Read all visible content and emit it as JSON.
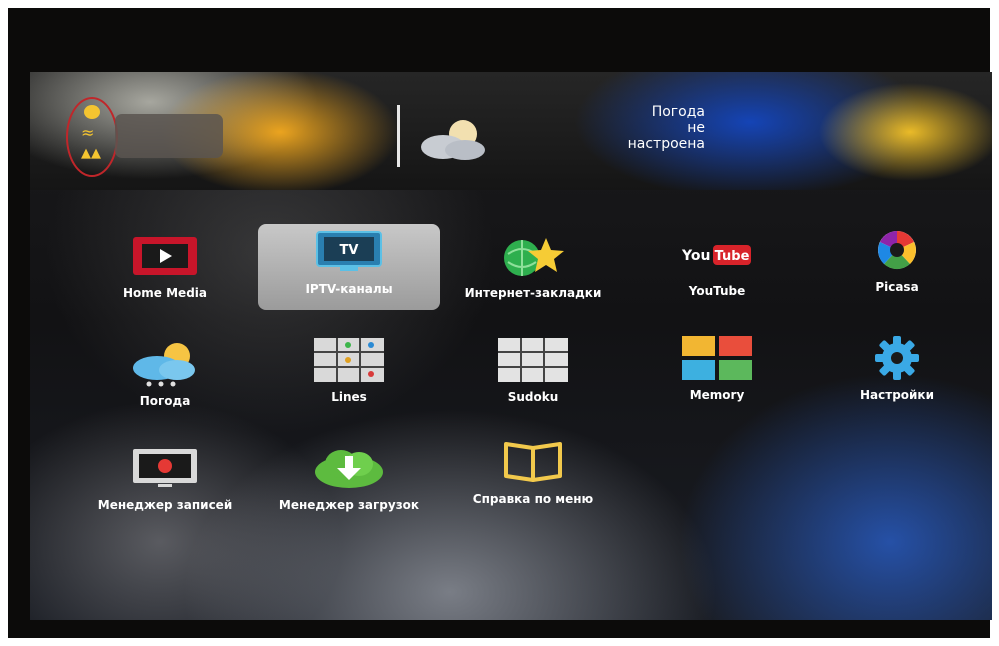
{
  "header": {
    "weather_line1": "Погода",
    "weather_line2": "не",
    "weather_line3": "настроена"
  },
  "menu": {
    "selected_item": "IPTV-каналы",
    "items": [
      {
        "label": "Home Media",
        "icon": "film-play-icon"
      },
      {
        "label": "IPTV-каналы",
        "icon": "tv-icon"
      },
      {
        "label": "Интернет-закладки",
        "icon": "globe-star-icon"
      },
      {
        "label": "YouTube",
        "icon": "youtube-logo-icon"
      },
      {
        "label": "Picasa",
        "icon": "picasa-icon"
      },
      {
        "label": "Погода",
        "icon": "weather-cloud-sun-icon"
      },
      {
        "label": "Lines",
        "icon": "lines-grid-icon"
      },
      {
        "label": "Sudoku",
        "icon": "sudoku-grid-icon"
      },
      {
        "label": "Memory",
        "icon": "memory-cards-icon"
      },
      {
        "label": "Настройки",
        "icon": "gear-icon"
      },
      {
        "label": "Менеджер записей",
        "icon": "record-tv-icon"
      },
      {
        "label": "Менеджер загрузок",
        "icon": "download-cloud-icon"
      },
      {
        "label": "Справка по меню",
        "icon": "book-icon"
      }
    ]
  },
  "icon_text": {
    "tv": "TV",
    "youtube_you": "You",
    "youtube_tube": "Tube"
  },
  "colors": {
    "status_highlight": "#c0262a",
    "status_icon": "#f4c430",
    "selection": "#b0b0b0"
  }
}
